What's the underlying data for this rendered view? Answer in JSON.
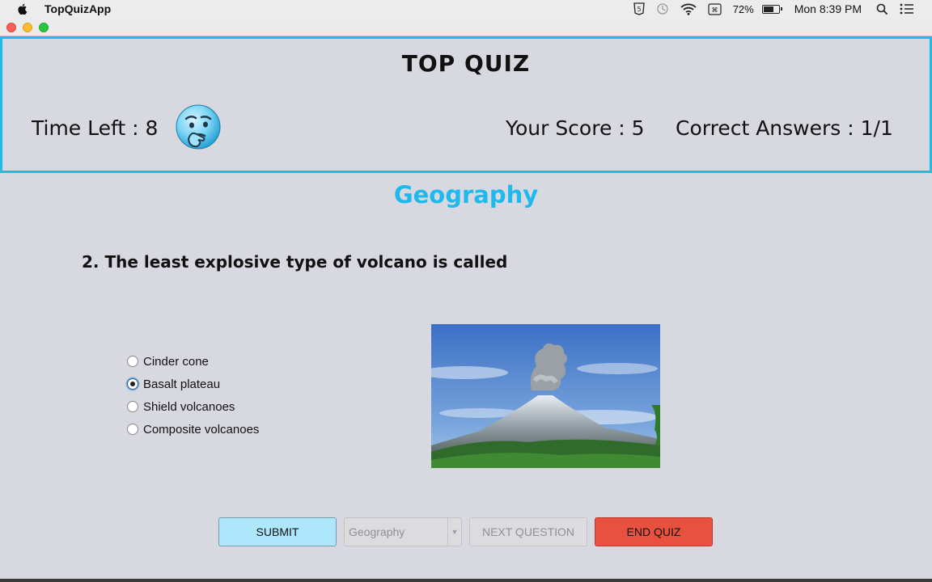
{
  "menubar": {
    "app_name": "TopQuizApp",
    "battery_percent": "72%",
    "battery_level": 0.72,
    "clock": "Mon 8:39 PM"
  },
  "header": {
    "title": "TOP QUIZ",
    "time_left": "Time Left : 8",
    "score": "Your Score : 5",
    "correct_answers": "Correct Answers : 1/1"
  },
  "quiz": {
    "category": "Geography",
    "question": "2. The least explosive type of volcano is called",
    "options": [
      {
        "label": "Cinder cone",
        "selected": false
      },
      {
        "label": "Basalt plateau",
        "selected": true
      },
      {
        "label": "Shield volcanoes",
        "selected": false
      },
      {
        "label": "Composite volcanoes",
        "selected": false
      }
    ]
  },
  "controls": {
    "submit_label": "SUBMIT",
    "category_select_value": "Geography",
    "next_label": "NEXT QUESTION",
    "end_label": "END QUIZ"
  },
  "colors": {
    "accent": "#1fb9ee",
    "submit_bg": "#aee7fb",
    "end_bg": "#e8503f"
  }
}
